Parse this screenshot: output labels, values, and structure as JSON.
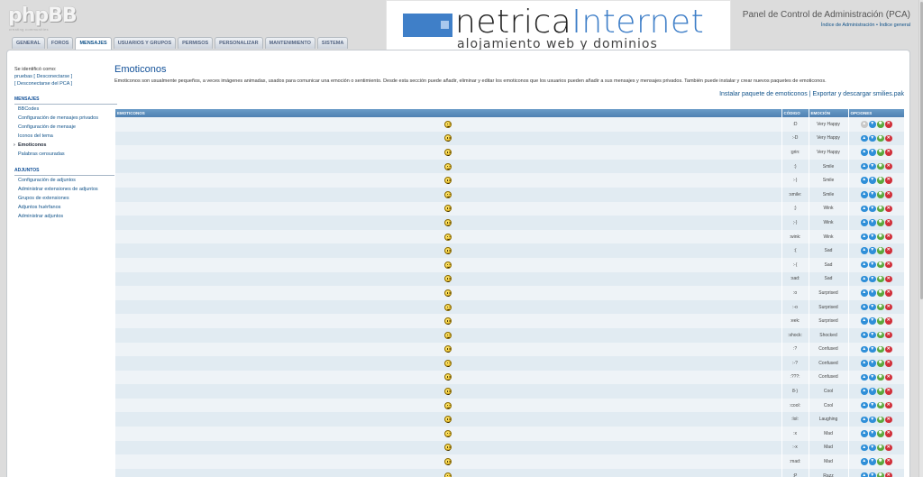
{
  "logo": {
    "text": "phpBB",
    "tagline": "creating communities"
  },
  "header": {
    "title": "Panel de Control de Administración (PCA)",
    "links": "Índice de Administración • Índice general"
  },
  "banner": {
    "brand_dark": "netrica",
    "brand_blue": "Internet",
    "tagline": "alojamiento web y dominios"
  },
  "tabs": [
    {
      "label": "General"
    },
    {
      "label": "Foros"
    },
    {
      "label": "Mensajes"
    },
    {
      "label": "Usuarios y grupos"
    },
    {
      "label": "Permisos"
    },
    {
      "label": "Personalizar"
    },
    {
      "label": "Mantenimiento"
    },
    {
      "label": "Sistema"
    }
  ],
  "sidebar": {
    "identified_as": "Se identificó como:",
    "user_line": "pruebas [ Desconectarse ]",
    "pca_line": "[ Desconectarse del PCA ]",
    "sections": [
      {
        "title": "Mensajes",
        "items": [
          {
            "label": "BBCodes"
          },
          {
            "label": "Configuración de mensajes privados"
          },
          {
            "label": "Configuración de mensaje"
          },
          {
            "label": "Iconos del tema"
          },
          {
            "label": "Emoticonos",
            "active": true
          },
          {
            "label": "Palabras censuradas"
          }
        ]
      },
      {
        "title": "Adjuntos",
        "items": [
          {
            "label": "Configuración de adjuntos"
          },
          {
            "label": "Administrar extensiones de adjuntos"
          },
          {
            "label": "Grupos de extensiones"
          },
          {
            "label": "Adjuntos huérfanos"
          },
          {
            "label": "Administrar adjuntos"
          }
        ]
      }
    ]
  },
  "main": {
    "title": "Emoticonos",
    "description": "Emoticonos son usualmente pequeños, a veces imágenes animadas, usados para comunicar una emoción o sentimiento. Desde esta sección puede añadir, eliminar y editar los emoticonos que los usuarios pueden añadir a sus mensajes y mensajes privados. También puede instalar y crear nuevos paquetes de emoticonos.",
    "actions": "Instalar paquete de emoticonos | Exportar y descargar smilies.pak"
  },
  "table": {
    "headers": [
      "Emoticonos",
      "Código",
      "Emoción",
      "Opciones"
    ],
    "rows": [
      {
        "code": ":D",
        "emotion": "Very Happy",
        "first": true
      },
      {
        "code": ":-D",
        "emotion": "Very Happy"
      },
      {
        "code": ":grin:",
        "emotion": "Very Happy"
      },
      {
        "code": ":)",
        "emotion": "Smile"
      },
      {
        "code": ":-)",
        "emotion": "Smile"
      },
      {
        "code": ":smile:",
        "emotion": "Smile"
      },
      {
        "code": ";)",
        "emotion": "Wink"
      },
      {
        "code": ";-)",
        "emotion": "Wink"
      },
      {
        "code": ":wink:",
        "emotion": "Wink"
      },
      {
        "code": ":(",
        "emotion": "Sad"
      },
      {
        "code": ":-(",
        "emotion": "Sad"
      },
      {
        "code": ":sad:",
        "emotion": "Sad"
      },
      {
        "code": ":o",
        "emotion": "Surprised"
      },
      {
        "code": ":-o",
        "emotion": "Surprised"
      },
      {
        "code": ":eek:",
        "emotion": "Surprised"
      },
      {
        "code": ":shock:",
        "emotion": "Shocked"
      },
      {
        "code": ":?",
        "emotion": "Confused"
      },
      {
        "code": ":-?",
        "emotion": "Confused"
      },
      {
        "code": ":???:",
        "emotion": "Confused"
      },
      {
        "code": "8-)",
        "emotion": "Cool"
      },
      {
        "code": ":cool:",
        "emotion": "Cool"
      },
      {
        "code": ":lol:",
        "emotion": "Laughing"
      },
      {
        "code": ":x",
        "emotion": "Mad"
      },
      {
        "code": ":-x",
        "emotion": "Mad"
      },
      {
        "code": ":mad:",
        "emotion": "Mad"
      },
      {
        "code": ":P",
        "emotion": "Razz"
      }
    ]
  },
  "colors": {
    "accent": "#105289",
    "table_header": "#5a8cbd",
    "row_alt": "#e1ebf2"
  }
}
